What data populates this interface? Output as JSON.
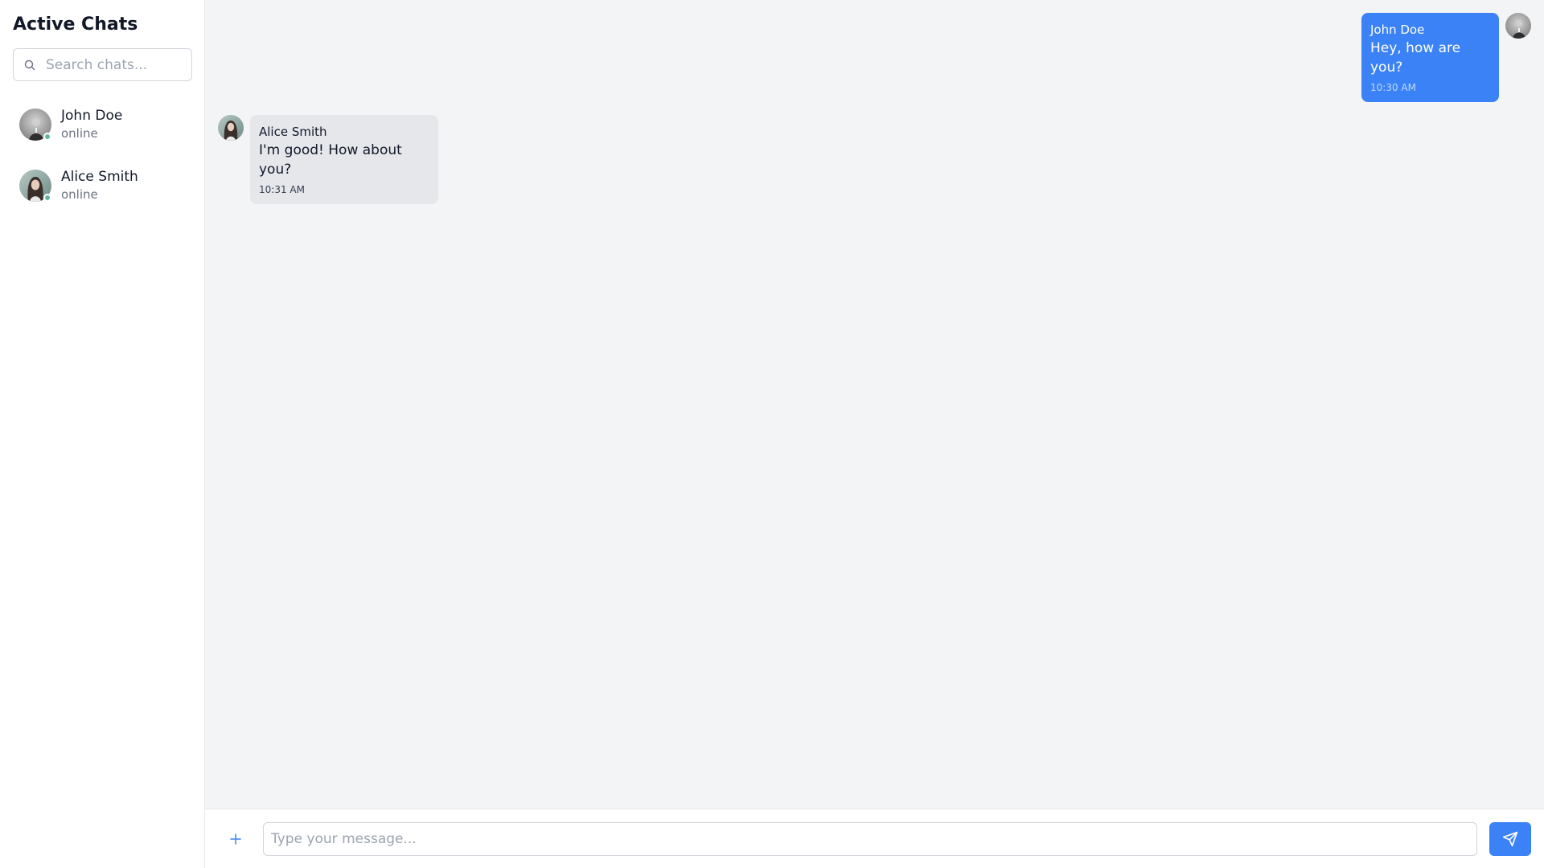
{
  "sidebar": {
    "title": "Active Chats",
    "search": {
      "placeholder": "Search chats...",
      "value": "",
      "icon": "search-icon"
    },
    "chats": [
      {
        "name": "John Doe",
        "status": "online",
        "status_color": "#5eb8a0"
      },
      {
        "name": "Alice Smith",
        "status": "online",
        "status_color": "#5eb8a0"
      }
    ]
  },
  "messages": [
    {
      "direction": "outgoing",
      "sender": "John Doe",
      "text": "Hey, how are you?",
      "time": "10:30 AM"
    },
    {
      "direction": "incoming",
      "sender": "Alice Smith",
      "text": "I'm good! How about you?",
      "time": "10:31 AM"
    }
  ],
  "composer": {
    "placeholder": "Type your message...",
    "value": "",
    "add_icon": "plus-icon",
    "send_icon": "send-icon"
  },
  "colors": {
    "accent": "#3b82f6",
    "incoming_bubble": "#e5e7eb",
    "online": "#5eb8a0"
  }
}
